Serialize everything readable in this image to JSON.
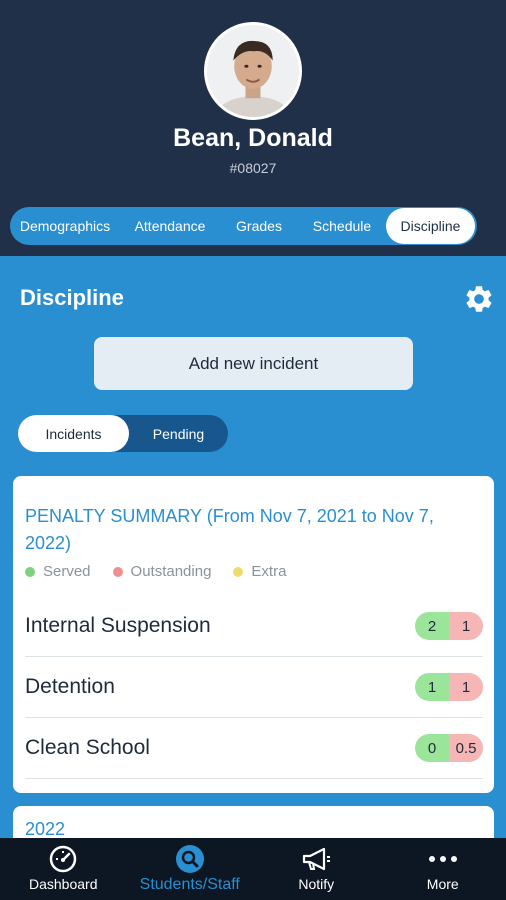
{
  "student": {
    "name": "Bean, Donald",
    "id": "#08027"
  },
  "tabs": [
    {
      "label": "Demographics"
    },
    {
      "label": "Attendance"
    },
    {
      "label": "Grades"
    },
    {
      "label": "Schedule"
    },
    {
      "label": "Discipline",
      "active": true
    }
  ],
  "section": {
    "title": "Discipline",
    "add_button": "Add new incident"
  },
  "segment": {
    "incidents": "Incidents",
    "pending": "Pending",
    "selected": "Incidents"
  },
  "summary": {
    "title": "PENALTY SUMMARY (From Nov 7, 2021 to Nov 7, 2022)",
    "legend": [
      {
        "label": "Served",
        "color": "#7fd17f"
      },
      {
        "label": "Outstanding",
        "color": "#ef8f8f"
      },
      {
        "label": "Extra",
        "color": "#f0dc6e"
      }
    ],
    "rows": [
      {
        "label": "Internal Suspension",
        "served": "2",
        "outstanding": "1"
      },
      {
        "label": "Detention",
        "served": "1",
        "outstanding": "1"
      },
      {
        "label": "Clean School",
        "served": "0",
        "outstanding": "0.5"
      }
    ]
  },
  "year_card": {
    "title": "2022"
  },
  "bottom_nav": [
    {
      "label": "Dashboard",
      "icon": "speedometer-icon"
    },
    {
      "label": "Students/Staff",
      "icon": "search-icon",
      "active": true
    },
    {
      "label": "Notify",
      "icon": "megaphone-icon"
    },
    {
      "label": "More",
      "icon": "more-dots-icon"
    }
  ],
  "colors": {
    "header_bg": "#213049",
    "accent": "#2a8fd0",
    "nav_bg": "#0d1623"
  }
}
